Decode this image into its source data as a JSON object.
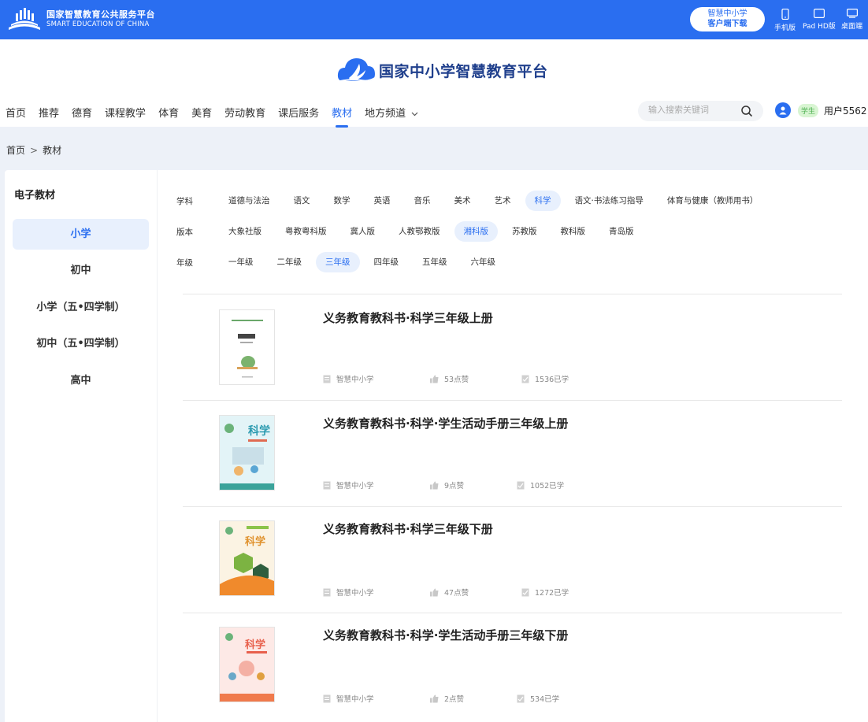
{
  "topbar": {
    "brand_cn": "国家智慧教育公共服务平台",
    "brand_en": "SMART EDUCATION OF CHINA",
    "download_line1": "智慧中小学",
    "download_line2": "客户端下载",
    "devices": [
      {
        "label": "手机版",
        "icon": "phone-icon"
      },
      {
        "label": "Pad HD版",
        "icon": "tablet-icon"
      },
      {
        "label": "桌面端",
        "icon": "desktop-icon"
      }
    ]
  },
  "header": {
    "site_title": "国家中小学智慧教育平台",
    "nav": [
      "首页",
      "推荐",
      "德育",
      "课程教学",
      "体育",
      "美育",
      "劳动教育",
      "课后服务",
      "教材",
      "地方频道"
    ],
    "nav_active": "教材",
    "search_placeholder": "输入搜索关键词",
    "role_badge": "学生",
    "user_name": "用户5562"
  },
  "breadcrumb": [
    "首页",
    "教材"
  ],
  "side": {
    "title": "电子教材",
    "items": [
      "小学",
      "初中",
      "小学（五•四学制）",
      "初中（五•四学制）",
      "高中"
    ],
    "active": "小学"
  },
  "filters": [
    {
      "label": "学科",
      "options": [
        "道德与法治",
        "语文",
        "数学",
        "英语",
        "音乐",
        "美术",
        "艺术",
        "科学",
        "语文·书法练习指导",
        "体育与健康（教师用书）"
      ],
      "selected": "科学"
    },
    {
      "label": "版本",
      "options": [
        "大象社版",
        "粤教粤科版",
        "冀人版",
        "人教鄂教版",
        "湘科版",
        "苏教版",
        "教科版",
        "青岛版"
      ],
      "selected": "湘科版"
    },
    {
      "label": "年级",
      "options": [
        "一年级",
        "二年级",
        "三年级",
        "四年级",
        "五年级",
        "六年级"
      ],
      "selected": "三年级"
    }
  ],
  "books": [
    {
      "title": "义务教育教科书·科学三年级上册",
      "publisher": "智慧中小学",
      "likes": "53点赞",
      "learned": "1536已学"
    },
    {
      "title": "义务教育教科书·科学·学生活动手册三年级上册",
      "publisher": "智慧中小学",
      "likes": "9点赞",
      "learned": "1052已学"
    },
    {
      "title": "义务教育教科书·科学三年级下册",
      "publisher": "智慧中小学",
      "likes": "47点赞",
      "learned": "1272已学"
    },
    {
      "title": "义务教育教科书·科学·学生活动手册三年级下册",
      "publisher": "智慧中小学",
      "likes": "2点赞",
      "learned": "534已学"
    }
  ],
  "colors": {
    "brand_blue": "#2a6ef0",
    "selected_bg": "#e8f0fd",
    "page_bg": "#edf1f8"
  }
}
